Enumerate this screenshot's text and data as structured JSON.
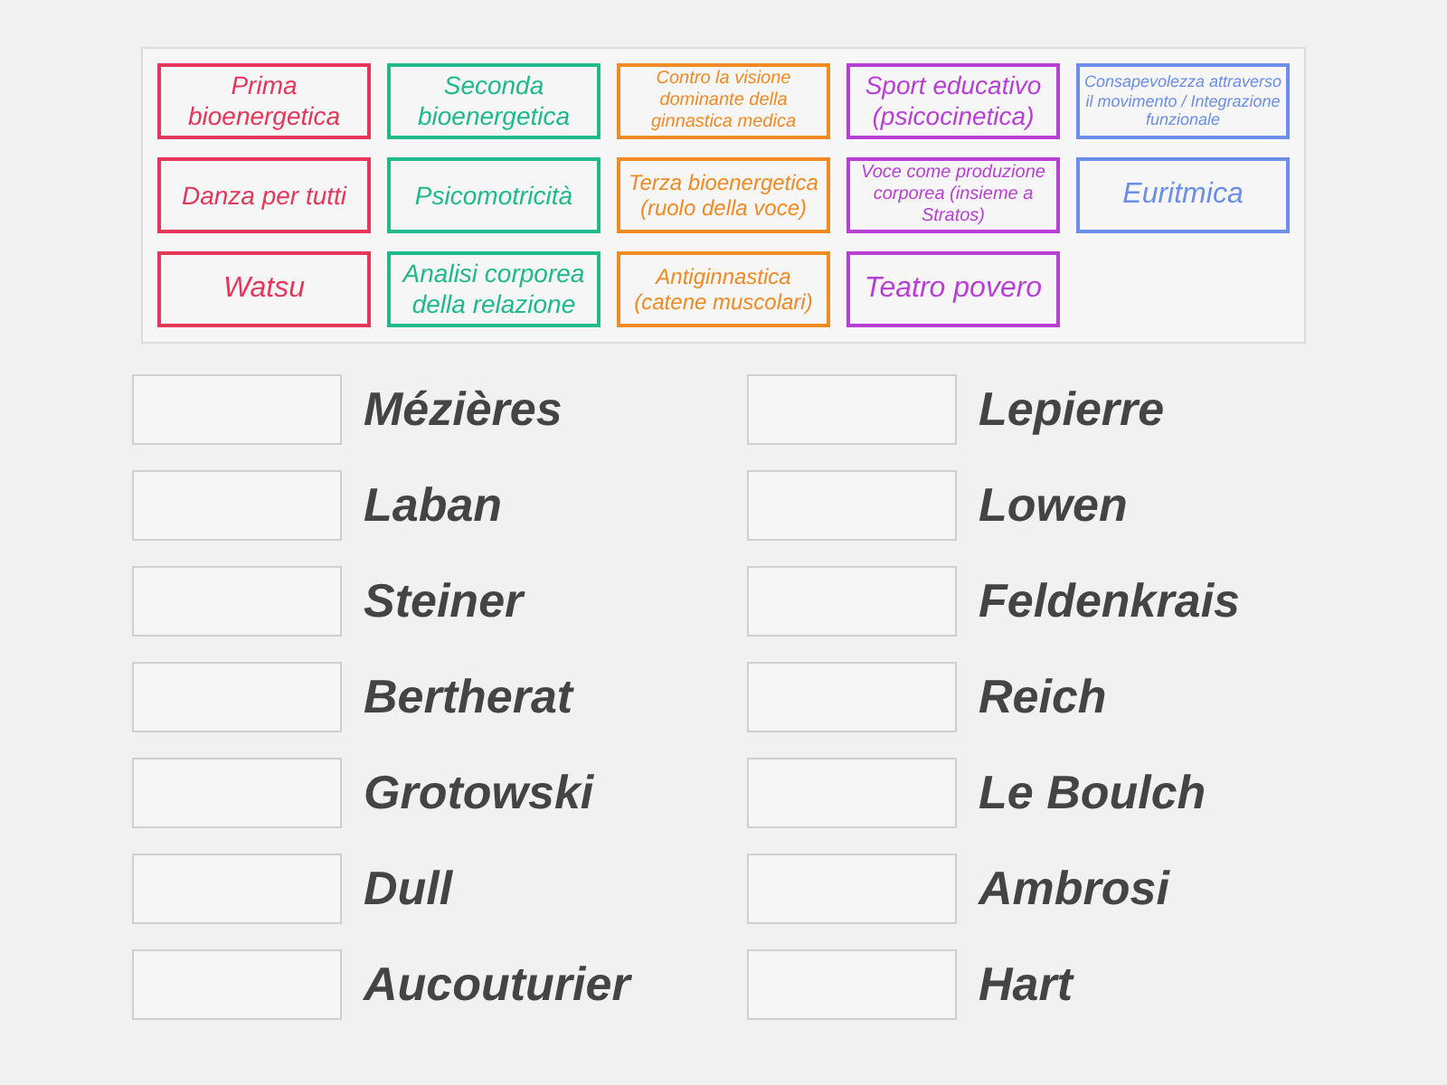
{
  "cards": [
    {
      "text": "Prima bioenergetica",
      "color": "#e5375a"
    },
    {
      "text": "Seconda bioenergetica",
      "color": "#1fb98a"
    },
    {
      "text": "Contro la visione dominante della ginnastica medica",
      "color": "#f08a24"
    },
    {
      "text": "Sport educativo (psicocinetica)",
      "color": "#b83fd6"
    },
    {
      "text": "Consapevolezza attraverso il movimento / Integrazione funzionale",
      "color": "#6b8ee8"
    },
    {
      "text": "Danza per tutti",
      "color": "#e5375a"
    },
    {
      "text": "Psicomotricità",
      "color": "#1fb98a"
    },
    {
      "text": "Terza bioenergetica (ruolo della voce)",
      "color": "#f08a24"
    },
    {
      "text": "Voce come produzione corporea (insieme a Stratos)",
      "color": "#b83fd6"
    },
    {
      "text": "Euritmica",
      "color": "#6b8ee8"
    },
    {
      "text": "Watsu",
      "color": "#e5375a"
    },
    {
      "text": "Analisi corporea della relazione",
      "color": "#1fb98a"
    },
    {
      "text": "Antiginnastica (catene muscolari)",
      "color": "#f08a24"
    },
    {
      "text": "Teatro povero",
      "color": "#b83fd6"
    }
  ],
  "targets": [
    {
      "label": "Mézières"
    },
    {
      "label": "Lepierre"
    },
    {
      "label": "Laban"
    },
    {
      "label": "Lowen"
    },
    {
      "label": "Steiner"
    },
    {
      "label": "Feldenkrais"
    },
    {
      "label": "Bertherat"
    },
    {
      "label": "Reich"
    },
    {
      "label": "Grotowski"
    },
    {
      "label": "Le Boulch"
    },
    {
      "label": "Dull"
    },
    {
      "label": "Ambrosi"
    },
    {
      "label": "Aucouturier"
    },
    {
      "label": "Hart"
    }
  ]
}
